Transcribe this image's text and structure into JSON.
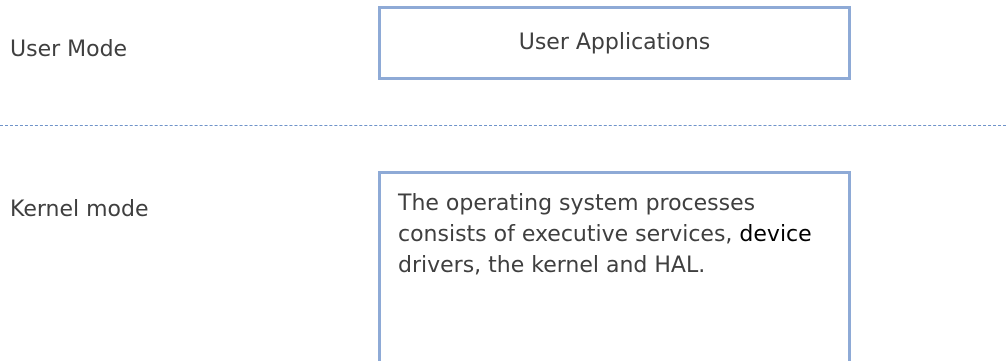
{
  "user_mode": {
    "label": "User Mode",
    "box_text": "User Applications"
  },
  "kernel_mode": {
    "label": "Kernel mode",
    "box_text_before": "The operating system processes consists of executive services, ",
    "box_text_highlight": "device",
    "box_text_after": " drivers, the kernel and HAL."
  },
  "colors": {
    "box_border": "#8eaad6",
    "divider": "#6f93c9",
    "text": "#3f3f3f",
    "highlight_text": "#000000"
  }
}
